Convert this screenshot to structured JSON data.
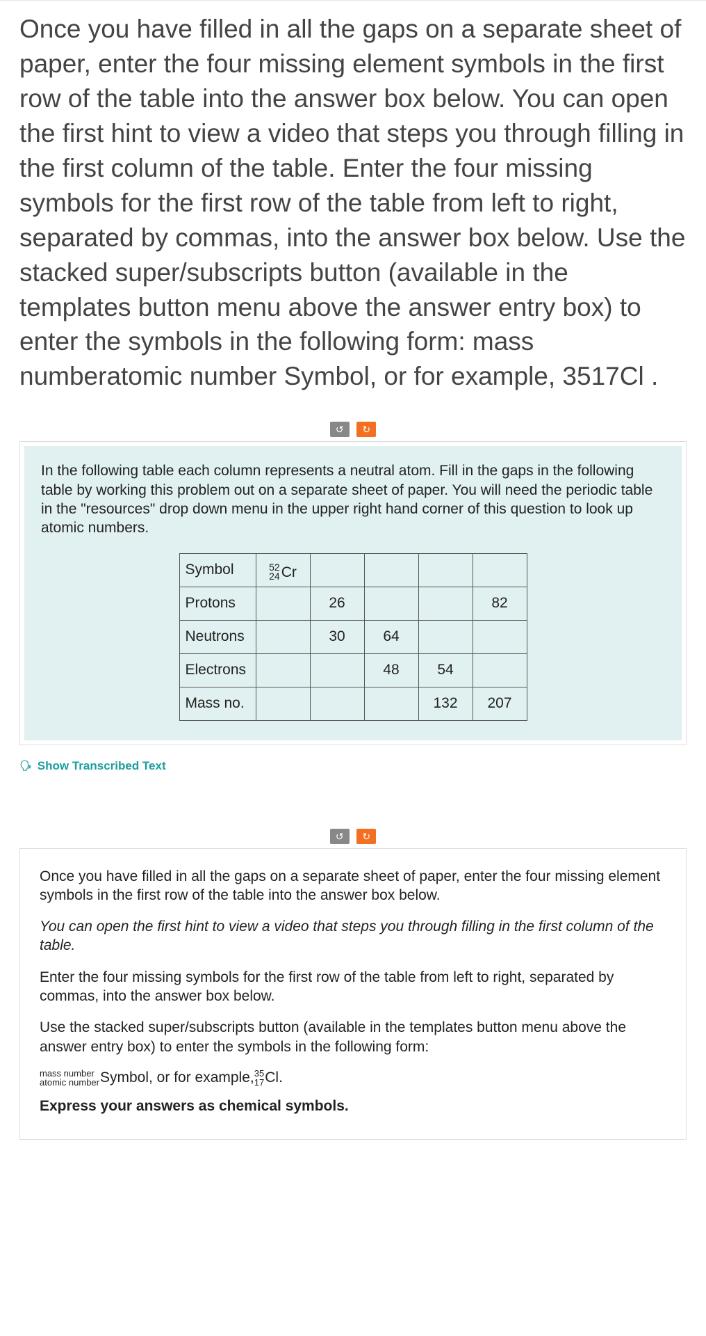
{
  "question": {
    "text": "Once you have filled in all the gaps on a separate sheet of paper, enter the four missing element symbols in the first row of the table into the answer box below. You can open the first hint to view a video that steps you through filling in the first column of the table. Enter the four missing symbols for the first row of the table from left to right, separated by commas, into the answer box below. Use the stacked super/subscripts button (available in the templates button menu above the answer entry box) to enter the symbols in the following form: mass numberatomic number Symbol, or for example, 3517Cl ."
  },
  "panel1": {
    "instructions": "In the following table each column represents a neutral atom. Fill in the gaps in the following table by working this problem out on a separate sheet of paper. You will need the periodic table in the \"resources\" drop down menu in the upper right hand corner of this question to look up atomic numbers.",
    "table": {
      "rows": [
        "Symbol",
        "Protons",
        "Neutrons",
        "Electrons",
        "Mass no."
      ],
      "symbol": {
        "mass": "52",
        "atomic": "24",
        "elem": "Cr"
      },
      "protons": [
        "",
        "26",
        "",
        "",
        "82"
      ],
      "neutrons": [
        "",
        "30",
        "64",
        "",
        ""
      ],
      "electrons": [
        "",
        "",
        "48",
        "54",
        ""
      ],
      "massno": [
        "",
        "",
        "",
        "132",
        "207"
      ]
    }
  },
  "transcribed_label": "Show Transcribed Text",
  "panel2": {
    "p1": "Once you have filled in all the gaps on a separate sheet of paper, enter the four missing element symbols in the first row of the table into the answer box below.",
    "p2": "You can open the first hint to view a video that steps you through filling in the first column of the table.",
    "p3": "Enter the four missing symbols for the first row of the table from left to right, separated by commas, into the answer box below.",
    "p4": "Use the stacked super/subscripts button (available in the templates button menu above the answer entry box) to enter the symbols in the following form:",
    "formula": {
      "top": "mass number",
      "bottom": "atomic number",
      "mid": "Symbol, or for example, ",
      "ex_mass": "35",
      "ex_atomic": "17",
      "ex_elem": "Cl",
      "period": "."
    },
    "p5": "Express your answers as chemical symbols."
  }
}
